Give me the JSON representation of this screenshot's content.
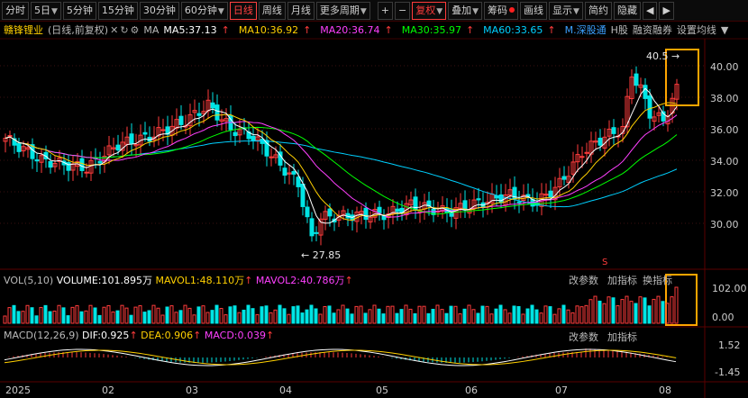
{
  "toolbar": {
    "items": [
      {
        "label": "分时"
      },
      {
        "label": "5日",
        "chev": true
      },
      {
        "label": "5分钟"
      },
      {
        "label": "15分钟"
      },
      {
        "label": "30分钟"
      },
      {
        "label": "60分钟",
        "chev": true
      },
      {
        "label": "日线",
        "active": true
      },
      {
        "label": "周线"
      },
      {
        "label": "月线"
      },
      {
        "label": "更多周期",
        "chev": true
      }
    ],
    "plus": "+",
    "minus": "−",
    "fuquan": "复权",
    "diejia": "叠加",
    "chouma": "筹码",
    "huaxian": "画线",
    "xianshi": "显示",
    "jianyue": "简约",
    "yincang": "隐藏"
  },
  "info": {
    "name": "赣锋锂业",
    "sub": "(日线,前复权)",
    "ma_label": "MA",
    "ma5": "MA5:37.13",
    "ma10": "MA10:36.92",
    "ma20": "MA20:36.74",
    "ma30": "MA30:35.97",
    "ma60": "MA60:33.65",
    "m_shen": "M.深股通",
    "h_gu": "H股",
    "rongzi": "融资融券",
    "shezhi": "设置均线"
  },
  "price_axis": [
    "40.00",
    "38.00",
    "36.00",
    "34.00",
    "32.00",
    "30.00"
  ],
  "annotations": {
    "high": "40.5",
    "low": "27.85"
  },
  "vol": {
    "title": "VOL(5,10)",
    "volume": "VOLUME:101.895万",
    "mavol1": "MAVOL1:48.110万",
    "mavol2": "MAVOL2:40.786万",
    "axis_top": "102.00",
    "axis_bottom": "0.00",
    "btn1": "改参数",
    "btn2": "加指标",
    "btn3": "换指标"
  },
  "macd": {
    "title": "MACD(12,26,9)",
    "dif": "DIF:0.925",
    "dea": "DEA:0.906",
    "macd": "MACD:0.039",
    "axis_top": "1.52",
    "axis_bottom": "-1.45",
    "btn1": "改参数",
    "btn2": "加指标"
  },
  "months": [
    "2025",
    "02",
    "03",
    "04",
    "05",
    "06",
    "07",
    "08"
  ],
  "colors": {
    "up": "#ff3c3c",
    "down": "#00e5e5",
    "ma5": "#ffffff",
    "ma10": "#ffd000",
    "ma20": "#ff40ff",
    "ma30": "#00ff00",
    "ma60": "#00d0ff",
    "highlight": "#ffa500"
  },
  "icons": [
    "gear-icon",
    "refresh-icon",
    "close-icon",
    "chevron-down-icon",
    "caret-left-icon",
    "caret-right-icon"
  ]
}
